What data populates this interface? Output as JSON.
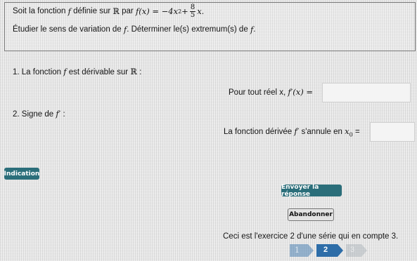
{
  "statement": {
    "intro": "Soit la fonction",
    "f": "f",
    "defined": "définie sur",
    "R": "ℝ",
    "par": "par",
    "formula_lhs": "f(x) = −4x",
    "exp": "2",
    "plus": " + ",
    "frac_num": "8",
    "frac_den": "5",
    "x_end": "x.",
    "task_prefix": "Étudier le sens de variation de",
    "task_f": "f",
    "task_middle": ". Déterminer le(s) extremum(s) de",
    "task_f2": "f",
    "task_end": "."
  },
  "q1": {
    "prefix": "1. La fonction",
    "f": "f",
    "middle": "est dérivable sur",
    "R": "ℝ",
    "suffix": ":",
    "prompt_text": "Pour tout réel x,",
    "prompt_math": "f′(x) ="
  },
  "q2": {
    "label": "2. Signe de",
    "fprime": "f′",
    "colon": ":",
    "prompt_text": "La fonction dérivée",
    "fprime2": "f′",
    "prompt_text2": "s'annule en",
    "x0": "x",
    "x0_sub": "0",
    "equals": "="
  },
  "buttons": {
    "indication": "Indication",
    "submit": "Envoyer la réponse",
    "abandon": "Abandonner"
  },
  "series_info": "Ceci est l'exercice 2 d'une série qui en compte 3.",
  "pager": {
    "prev": "1",
    "current": "2",
    "next": "3"
  },
  "colors": {
    "accent": "#2b6e7a",
    "pager_active": "#2d6da8"
  }
}
